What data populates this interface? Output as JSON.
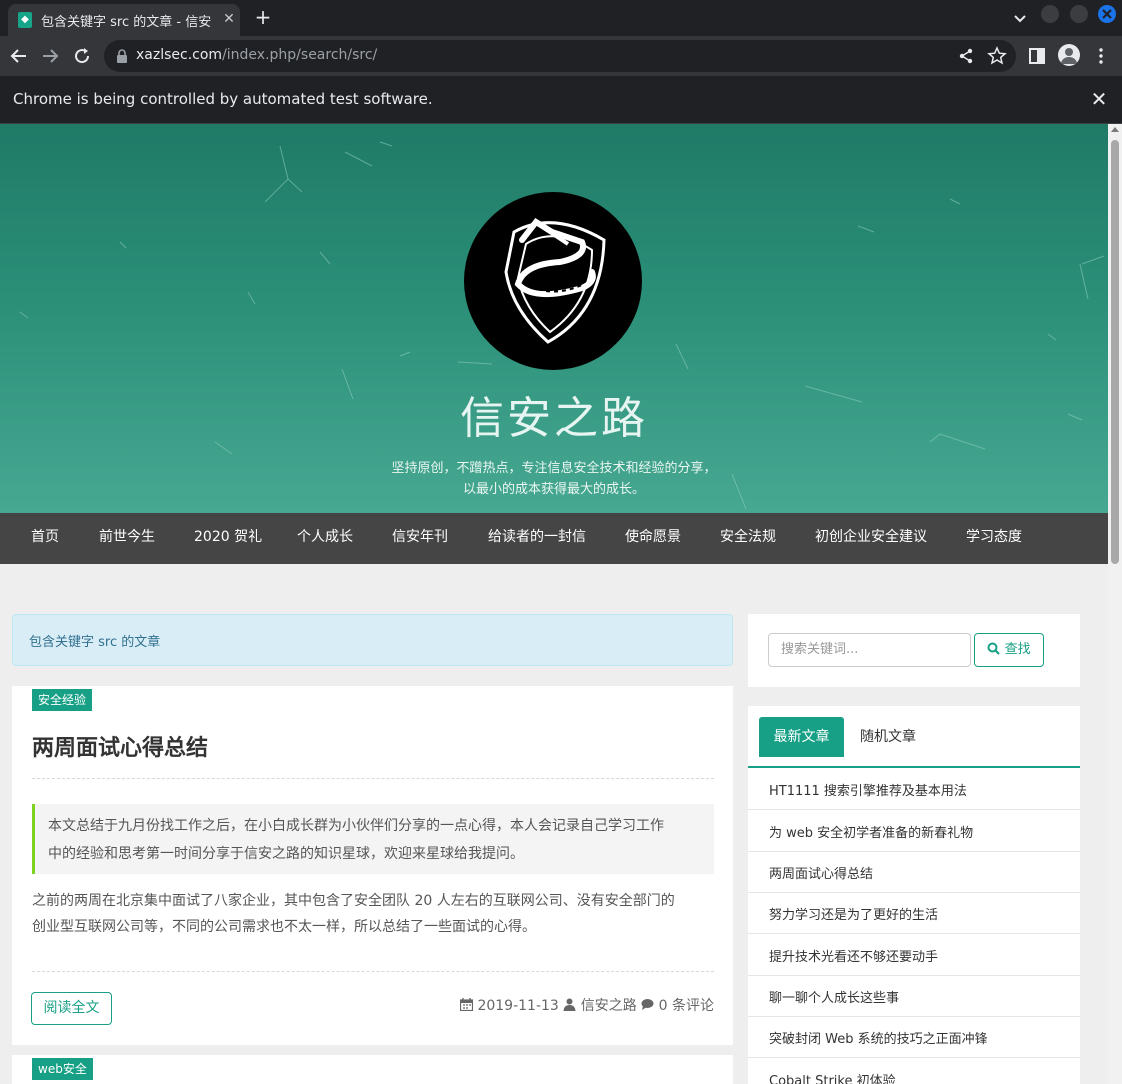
{
  "browser": {
    "tab_title": "包含关键字 src 的文章 - 信安之路",
    "url_host": "xazlsec.com",
    "url_path": "/index.php/search/src/",
    "infobar_text": "Chrome is being controlled by automated test software."
  },
  "site": {
    "title": "信安之路",
    "desc_line1": "坚持原创，不蹭热点，专注信息安全技术和经验的分享，",
    "desc_line2": "以最小的成本获得最大的成长。"
  },
  "nav": [
    "首页",
    "前世今生",
    "2020 贺礼",
    "个人成长",
    "信安年刊",
    "给读者的一封信",
    "使命愿景",
    "安全法规",
    "初创企业安全建议",
    "学习态度"
  ],
  "search_notice": "包含关键字 src 的文章",
  "posts": [
    {
      "category": "安全经验",
      "title": "两周面试心得总结",
      "summary_line1": "本文总结于九月份找工作之后，在小白成长群为小伙伴们分享的一点心得，本人会记录自己学习工作",
      "summary_line2": "中的经验和思考第一时间分享于信安之路的知识星球，欢迎来星球给我提问。",
      "excerpt_line1": "之前的两周在北京集中面试了八家企业，其中包含了安全团队 20 人左右的互联网公司、没有安全部门的",
      "excerpt_line2": "创业型互联网公司等，不同的公司需求也不太一样，所以总结了一些面试的心得。",
      "read_more": "阅读全文",
      "date": "2019-11-13",
      "author": "信安之路",
      "comments": "0 条评论"
    },
    {
      "category": "web安全"
    }
  ],
  "sidebar": {
    "search_placeholder": "搜索关键词...",
    "search_button": "查找",
    "tab_latest": "最新文章",
    "tab_random": "随机文章",
    "latest": [
      "HT1111 搜索引擎推荐及基本用法",
      "为 web 安全初学者准备的新春礼物",
      "两周面试心得总结",
      "努力学习还是为了更好的生活",
      "提升技术光看还不够还要动手",
      "聊一聊个人成长这些事",
      "突破封闭 Web 系统的技巧之正面冲锋",
      "Cobalt Strike 初体验"
    ]
  },
  "colors": {
    "accent": "#17a085",
    "nav_bg": "#454545",
    "hero_top": "#1f7a66",
    "hero_bottom": "#47a892"
  }
}
